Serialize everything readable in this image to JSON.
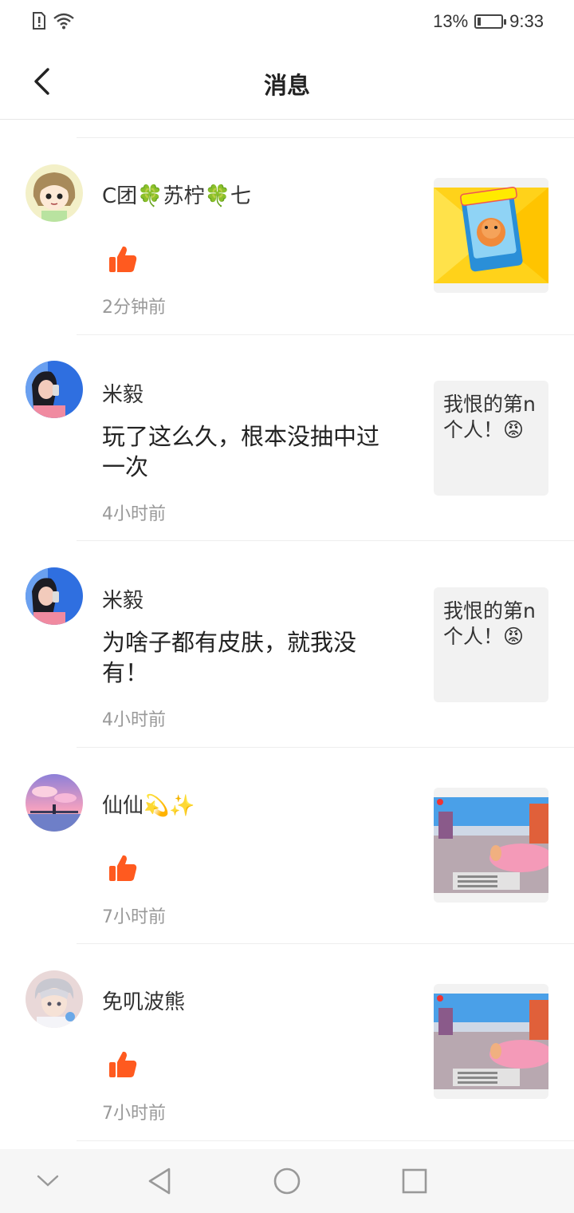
{
  "status_bar": {
    "battery": "13%",
    "time": "9:33"
  },
  "header": {
    "title": "消息"
  },
  "messages": [
    {
      "username": "C团🍀苏柠🍀七",
      "type": "like",
      "time": "2分钟前",
      "thumbnail": {
        "kind": "image",
        "description_icon": "game-card-image"
      }
    },
    {
      "username": "米毅",
      "type": "comment",
      "content": "玩了这么久，根本没抽中过一次",
      "time": "4小时前",
      "thumbnail": {
        "kind": "text",
        "text": "我恨的第n个人！😡"
      }
    },
    {
      "username": "米毅",
      "type": "comment",
      "content": "为啥子都有皮肤，就我没有！",
      "time": "4小时前",
      "thumbnail": {
        "kind": "text",
        "text": "我恨的第n个人！😡"
      }
    },
    {
      "username": "仙仙💫✨",
      "type": "like",
      "time": "7小时前",
      "thumbnail": {
        "kind": "image",
        "description_icon": "game-screenshot-image"
      }
    },
    {
      "username": "免叽波熊",
      "type": "like",
      "time": "7小时前",
      "thumbnail": {
        "kind": "image",
        "description_icon": "game-screenshot-image"
      }
    }
  ],
  "colors": {
    "accent": "#ff5a1f",
    "time_text": "#999999",
    "divider": "#eeeeee"
  }
}
